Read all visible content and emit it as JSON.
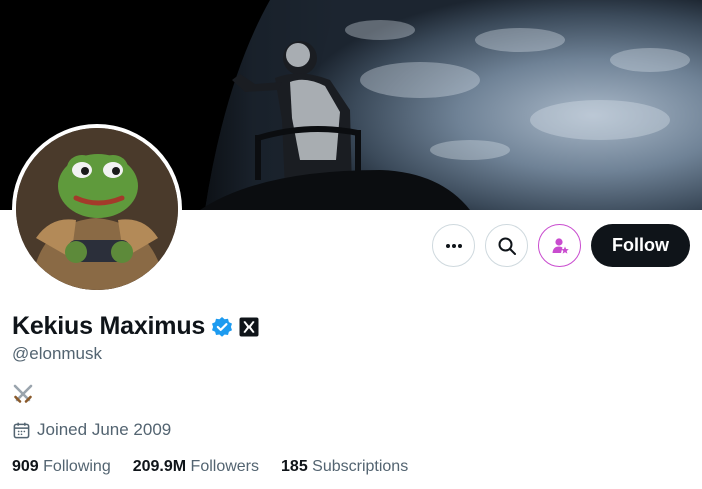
{
  "banner": {
    "description_icon": "astronaut-earth-banner"
  },
  "avatar": {
    "icon": "pepe-warrior-avatar"
  },
  "actions": {
    "more_icon": "more-dots-icon",
    "search_icon": "search-icon",
    "subscribe_icon": "subscribe-person-star-icon",
    "follow_label": "Follow"
  },
  "profile": {
    "display_name": "Kekius Maximus",
    "verified_icon": "verified-badge-icon",
    "affiliate_icon": "x-logo-badge-icon",
    "handle": "@elonmusk",
    "bio_icon": "crossed-swords-icon",
    "joined_icon": "calendar-icon",
    "joined": "Joined June 2009"
  },
  "stats": {
    "following_count": "909",
    "following_label": "Following",
    "followers_count": "209.9M",
    "followers_label": "Followers",
    "subscriptions_count": "185",
    "subscriptions_label": "Subscriptions"
  },
  "colors": {
    "text_primary": "#0f1419",
    "text_secondary": "#536471",
    "verified_blue": "#1d9bf0",
    "subscribe_magenta": "#c94ccf"
  }
}
